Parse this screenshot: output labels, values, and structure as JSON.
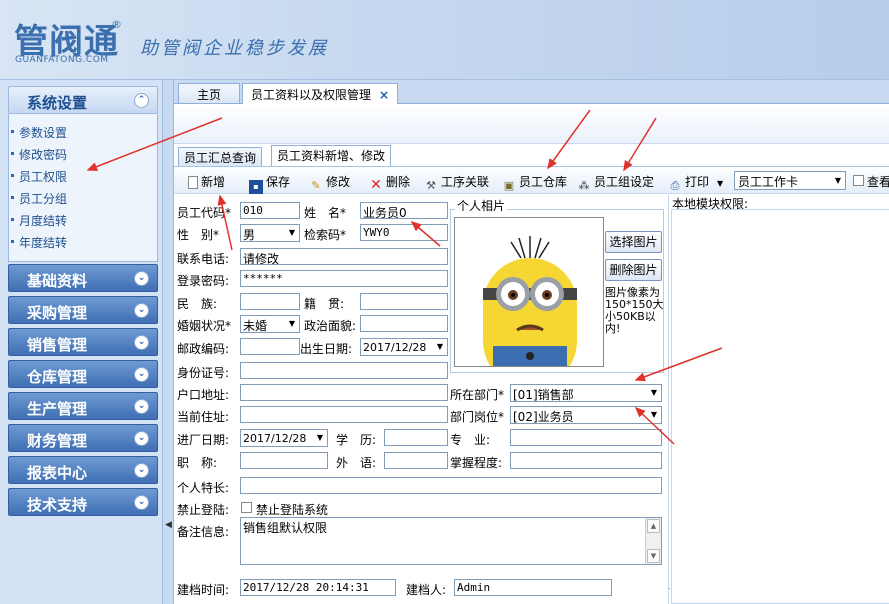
{
  "header": {
    "logo": "管阀通",
    "logo_reg": "®",
    "logo_sub": "GUANFATONG.COM",
    "slogan": "助管阀企业稳步发展"
  },
  "sidebar": {
    "system_group": {
      "title": "系统设置",
      "items": [
        {
          "label": "参数设置"
        },
        {
          "label": "修改密码"
        },
        {
          "label": "员工权限"
        },
        {
          "label": "员工分组"
        },
        {
          "label": "月度结转"
        },
        {
          "label": "年度结转"
        }
      ]
    },
    "groups": [
      {
        "title": "基础资料"
      },
      {
        "title": "采购管理"
      },
      {
        "title": "销售管理"
      },
      {
        "title": "仓库管理"
      },
      {
        "title": "生产管理"
      },
      {
        "title": "财务管理"
      },
      {
        "title": "报表中心"
      },
      {
        "title": "技术支持"
      }
    ]
  },
  "tabs": {
    "home": "主页",
    "active": "员工资料以及权限管理",
    "close": "×"
  },
  "inner_tabs": {
    "summary": "员工汇总查询",
    "edit": "员工资料新增、修改"
  },
  "toolbar": {
    "new": "新增",
    "save": "保存",
    "edit": "修改",
    "delete": "删除",
    "process": "工序关联",
    "warehouse": "员工仓库",
    "group_setting": "员工组设定",
    "print": "打印",
    "print_combo": "员工工作卡",
    "view_label": "查看"
  },
  "form": {
    "labels": {
      "code": "员工代码*",
      "name": "姓　名*",
      "gender": "性　别*",
      "search_code": "检索码*",
      "phone": "联系电话:",
      "password": "登录密码:",
      "nation": "民　族:",
      "native": "籍　贯:",
      "marital": "婚姻状况*",
      "political": "政治面貌:",
      "postcode": "邮政编码:",
      "birth": "出生日期:",
      "id_card": "身份证号:",
      "hukou": "户口地址:",
      "address": "当前住址:",
      "dept": "所在部门*",
      "post": "部门岗位*",
      "join_date": "进厂日期:",
      "education": "学　历:",
      "major": "专　业:",
      "title": "职　称:",
      "language": "外　语:",
      "mastery": "掌握程度:",
      "specialty": "个人特长:",
      "forbid_login": "禁止登陆:",
      "forbid_system": "禁止登陆系统",
      "remark": "备注信息:",
      "create_time": "建档时间:",
      "creator": "建档人:",
      "photo": "个人相片"
    },
    "values": {
      "code": "010",
      "name": "业务员0",
      "gender": "男",
      "search_code": "YWY0",
      "phone": "请修改",
      "password": "******",
      "marital": "未婚",
      "birth": "2017/12/28",
      "dept": "[01]销售部",
      "post": "[02]业务员",
      "join_date": "2017/12/28",
      "remark": "销售组默认权限",
      "create_time": "2017/12/28 20:14:31",
      "creator": "Admin"
    },
    "photo_buttons": {
      "select": "选择图片",
      "delete": "删除图片"
    },
    "photo_note": "图片像素为150*150大小50KB以内!"
  },
  "right_panel": {
    "title": "本地模块权限:"
  },
  "colors": {
    "accent": "#3b6fae",
    "sidebar_collapsed": "#4a7bbd",
    "arrow": "#e0312a"
  }
}
